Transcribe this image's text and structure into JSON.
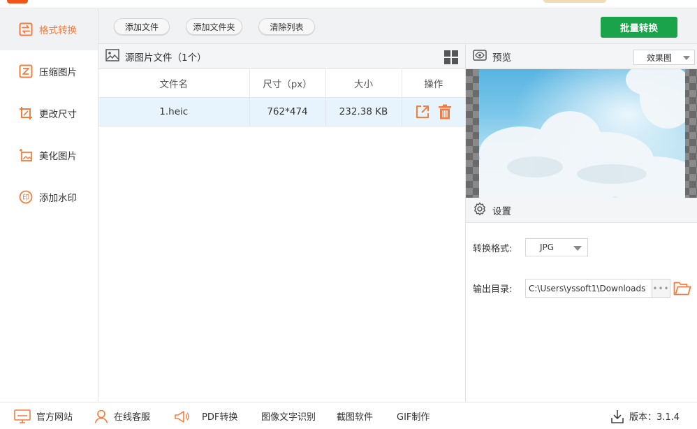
{
  "sidebar": {
    "items": [
      {
        "label": "格式转换",
        "icon": "convert-icon",
        "active": true
      },
      {
        "label": "压缩图片",
        "icon": "compress-icon"
      },
      {
        "label": "更改尺寸",
        "icon": "resize-icon"
      },
      {
        "label": "美化图片",
        "icon": "beautify-icon"
      },
      {
        "label": "添加水印",
        "icon": "watermark-icon"
      }
    ]
  },
  "toolbar": {
    "add_file": "添加文件",
    "add_folder": "添加文件夹",
    "clear_list": "清除列表",
    "batch_convert": "批量转换"
  },
  "file_panel": {
    "title": "源图片文件（1个）",
    "columns": [
      "文件名",
      "尺寸（px）",
      "大小",
      "操作"
    ],
    "rows": [
      {
        "name": "1.heic",
        "dimensions": "762*474",
        "size": "232.38 KB"
      }
    ]
  },
  "preview": {
    "title": "预览",
    "mode": "效果图"
  },
  "settings": {
    "title": "设置",
    "format_label": "转换格式:",
    "format_value": "JPG",
    "output_label": "输出目录:",
    "output_path": "C:\\Users\\yssoft1\\Downloads"
  },
  "bottom": {
    "website": "官方网站",
    "support": "在线客服",
    "pdf": "PDF转换",
    "ocr": "图像文字识别",
    "screenshot": "截图软件",
    "gif": "GIF制作",
    "version": "版本：3.1.4"
  },
  "colors": {
    "accent": "#f47c3c",
    "primary_button": "#1aa34a",
    "selected_row": "#e8f4fd"
  }
}
